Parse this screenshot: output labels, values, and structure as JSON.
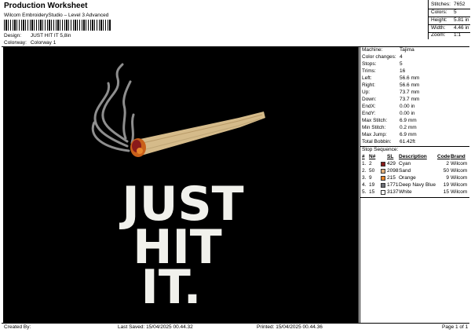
{
  "header": {
    "title": "Production Worksheet",
    "software": "Wilcom EmbroideryStudio – Level 3 Advanced",
    "design_label": "Design:",
    "design_value": "JUST HIT IT 5,8in",
    "colorway_label": "Colorway:",
    "colorway_value": "Colorway 1"
  },
  "stats": [
    {
      "label": "Stitches:",
      "value": "7652"
    },
    {
      "label": "Colors:",
      "value": "5"
    },
    {
      "label": "Height:",
      "value": "5.81 in"
    },
    {
      "label": "Width:",
      "value": "4.46 in"
    },
    {
      "label": "Zoom:",
      "value": "1:1"
    }
  ],
  "machine_info": [
    {
      "label": "Machine:",
      "value": "Tajima"
    },
    {
      "label": "Color changes:",
      "value": "4"
    },
    {
      "label": "Stops:",
      "value": "5"
    },
    {
      "label": "Trims:",
      "value": "16"
    },
    {
      "label": "Left:",
      "value": "56.6 mm"
    },
    {
      "label": "Right:",
      "value": "56.6 mm"
    },
    {
      "label": "Up:",
      "value": "73.7 mm"
    },
    {
      "label": "Down:",
      "value": "73.7 mm"
    },
    {
      "label": "EndX:",
      "value": "0.00 in"
    },
    {
      "label": "EndY:",
      "value": "0.00 in"
    },
    {
      "label": "Max Stitch:",
      "value": "6.9 mm"
    },
    {
      "label": "Min Stitch:",
      "value": "0.2 mm"
    },
    {
      "label": "Max Jump:",
      "value": "6.9 mm"
    },
    {
      "label": "Total Bobbin:",
      "value": "61.42ft"
    }
  ],
  "stop_sequence": {
    "heading": "Stop Sequence:",
    "columns": {
      "num": "#",
      "n": "N#",
      "sl": "SL",
      "desc": "Description",
      "code": "Code",
      "brand": "Brand"
    },
    "rows": [
      {
        "num": "1.",
        "n": "2",
        "sl": "429",
        "desc": "Cyan",
        "code": "2",
        "brand": "Wilcom",
        "color": "#8a1a1a"
      },
      {
        "num": "2.",
        "n": "50",
        "sl": "2098",
        "desc": "Sand",
        "code": "50",
        "brand": "Wilcom",
        "color": "#e3b07a"
      },
      {
        "num": "3.",
        "n": "9",
        "sl": "215",
        "desc": "Orange",
        "code": "9",
        "brand": "Wilcom",
        "color": "#e8862a"
      },
      {
        "num": "4.",
        "n": "19",
        "sl": "1771",
        "desc": "Deep Navy Blue",
        "code": "19",
        "brand": "Wilcom",
        "color": "#6d6f78"
      },
      {
        "num": "5.",
        "n": "15",
        "sl": "3137",
        "desc": "White",
        "code": "15",
        "brand": "Wilcom",
        "color": "#ffffff"
      }
    ]
  },
  "design": {
    "line1": "JUST",
    "line2": "HIT",
    "line3": "IT.",
    "colors": {
      "background": "#000000",
      "text": "#f1f1ec",
      "joint": "#d5bb8a",
      "ember": "#c9601a",
      "smoke": "#8e8e8e"
    }
  },
  "footer": {
    "created_by": "Created By:",
    "last_saved": "Last Saved: 15/04/2025 00.44.32",
    "printed": "Printed: 15/04/2025 00.44.36",
    "page": "Page 1 of 1"
  }
}
